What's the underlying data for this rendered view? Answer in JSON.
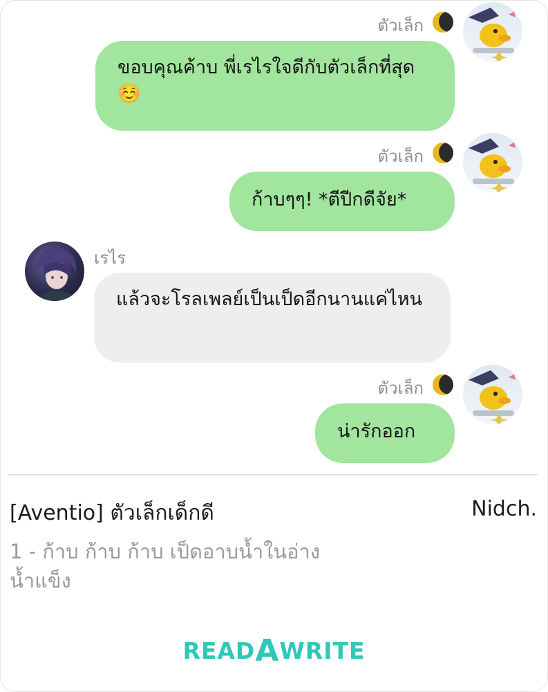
{
  "chat": {
    "messages": [
      {
        "sender": "ตัวเล็ก",
        "side": "right",
        "text": "ขอบคุณค้าบ พี่เรไรใจดีกับตัวเล็กที่สุด ☺️"
      },
      {
        "sender": "ตัวเล็ก",
        "side": "right",
        "text": "ก้าบๆๆ! *ตีปีกดีจัย*"
      },
      {
        "sender": "เรไร",
        "side": "left",
        "text": "แล้วจะโรลเพลย์เป็นเป็ดอีกนานแค่ไหน"
      },
      {
        "sender": "ตัวเล็ก",
        "side": "right",
        "text": "น่ารักออก"
      }
    ]
  },
  "footer": {
    "story_title": "[Aventio] ตัวเล็กเด็กดี",
    "author": "Nidch.",
    "chapter": "1 - ก้าบ ก้าบ ก้าบ เป็ดอาบน้ำในอ่างน้ำแข็ง",
    "brand_left": "READ",
    "brand_accent": "A",
    "brand_right": "WRITE"
  },
  "colors": {
    "bubble_outgoing": "#a2e59e",
    "bubble_incoming": "#eeeeee",
    "brand": "#2ec8b8",
    "moon": "#e8b71c"
  },
  "icons": {
    "sender_badge": "moon-icon",
    "avatar_outgoing": "duck-avatar",
    "avatar_incoming": "character-avatar"
  }
}
